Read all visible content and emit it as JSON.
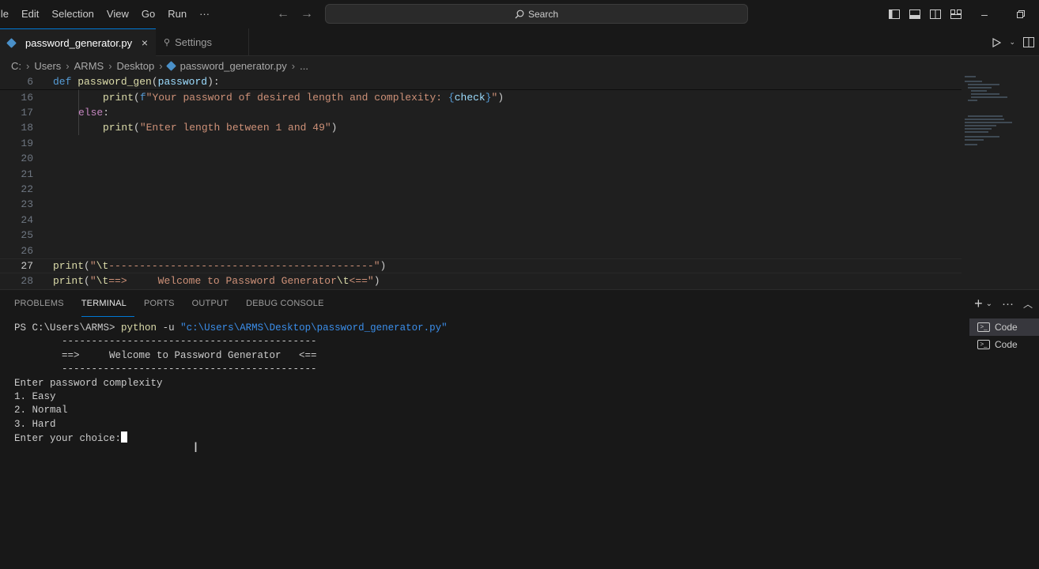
{
  "menu": [
    "ile",
    "Edit",
    "Selection",
    "View",
    "Go",
    "Run",
    "···"
  ],
  "search": {
    "label": "Search"
  },
  "tabs": [
    {
      "label": "password_generator.py",
      "close": "×"
    },
    {
      "label": "Settings"
    }
  ],
  "breadcrumb": [
    "C:",
    "Users",
    "ARMS",
    "Desktop",
    "password_generator.py",
    "..."
  ],
  "editor": {
    "lines": [
      {
        "num": "6",
        "code": "def password_gen(password):"
      },
      {
        "num": "16",
        "code": "print(f\"Your password of desired length and complexity: {check}\")"
      },
      {
        "num": "17",
        "code": "else:"
      },
      {
        "num": "18",
        "code": "print(\"Enter length between 1 and 49\")"
      },
      {
        "num": "19",
        "code": ""
      },
      {
        "num": "20",
        "code": ""
      },
      {
        "num": "21",
        "code": ""
      },
      {
        "num": "22",
        "code": ""
      },
      {
        "num": "23",
        "code": ""
      },
      {
        "num": "24",
        "code": ""
      },
      {
        "num": "25",
        "code": ""
      },
      {
        "num": "26",
        "code": ""
      },
      {
        "num": "27",
        "code": "print(\"\\t-------------------------------------------\")"
      },
      {
        "num": "28",
        "code": "print(\"\\t==>     Welcome to Password Generator\\t<==\")"
      }
    ]
  },
  "panel": {
    "tabs": [
      "PROBLEMS",
      "TERMINAL",
      "PORTS",
      "OUTPUT",
      "DEBUG CONSOLE"
    ],
    "active_tab": "TERMINAL",
    "terminal_instances": [
      "Code",
      "Code"
    ]
  },
  "terminal": {
    "prompt": "PS C:\\Users\\ARMS>",
    "command": "python",
    "flag": "-u",
    "path": "\"c:\\Users\\ARMS\\Desktop\\password_generator.py\"",
    "output": [
      "        -------------------------------------------",
      "        ==>     Welcome to Password Generator   <==",
      "        -------------------------------------------",
      "Enter password complexity",
      "1. Easy",
      "2. Normal",
      "3. Hard",
      "Enter your choice:"
    ]
  },
  "colors": {
    "accent": "#0078d4",
    "keyword": "#569cd6",
    "function": "#dcdcaa",
    "string": "#ce9178",
    "variable": "#9cdcfe"
  }
}
